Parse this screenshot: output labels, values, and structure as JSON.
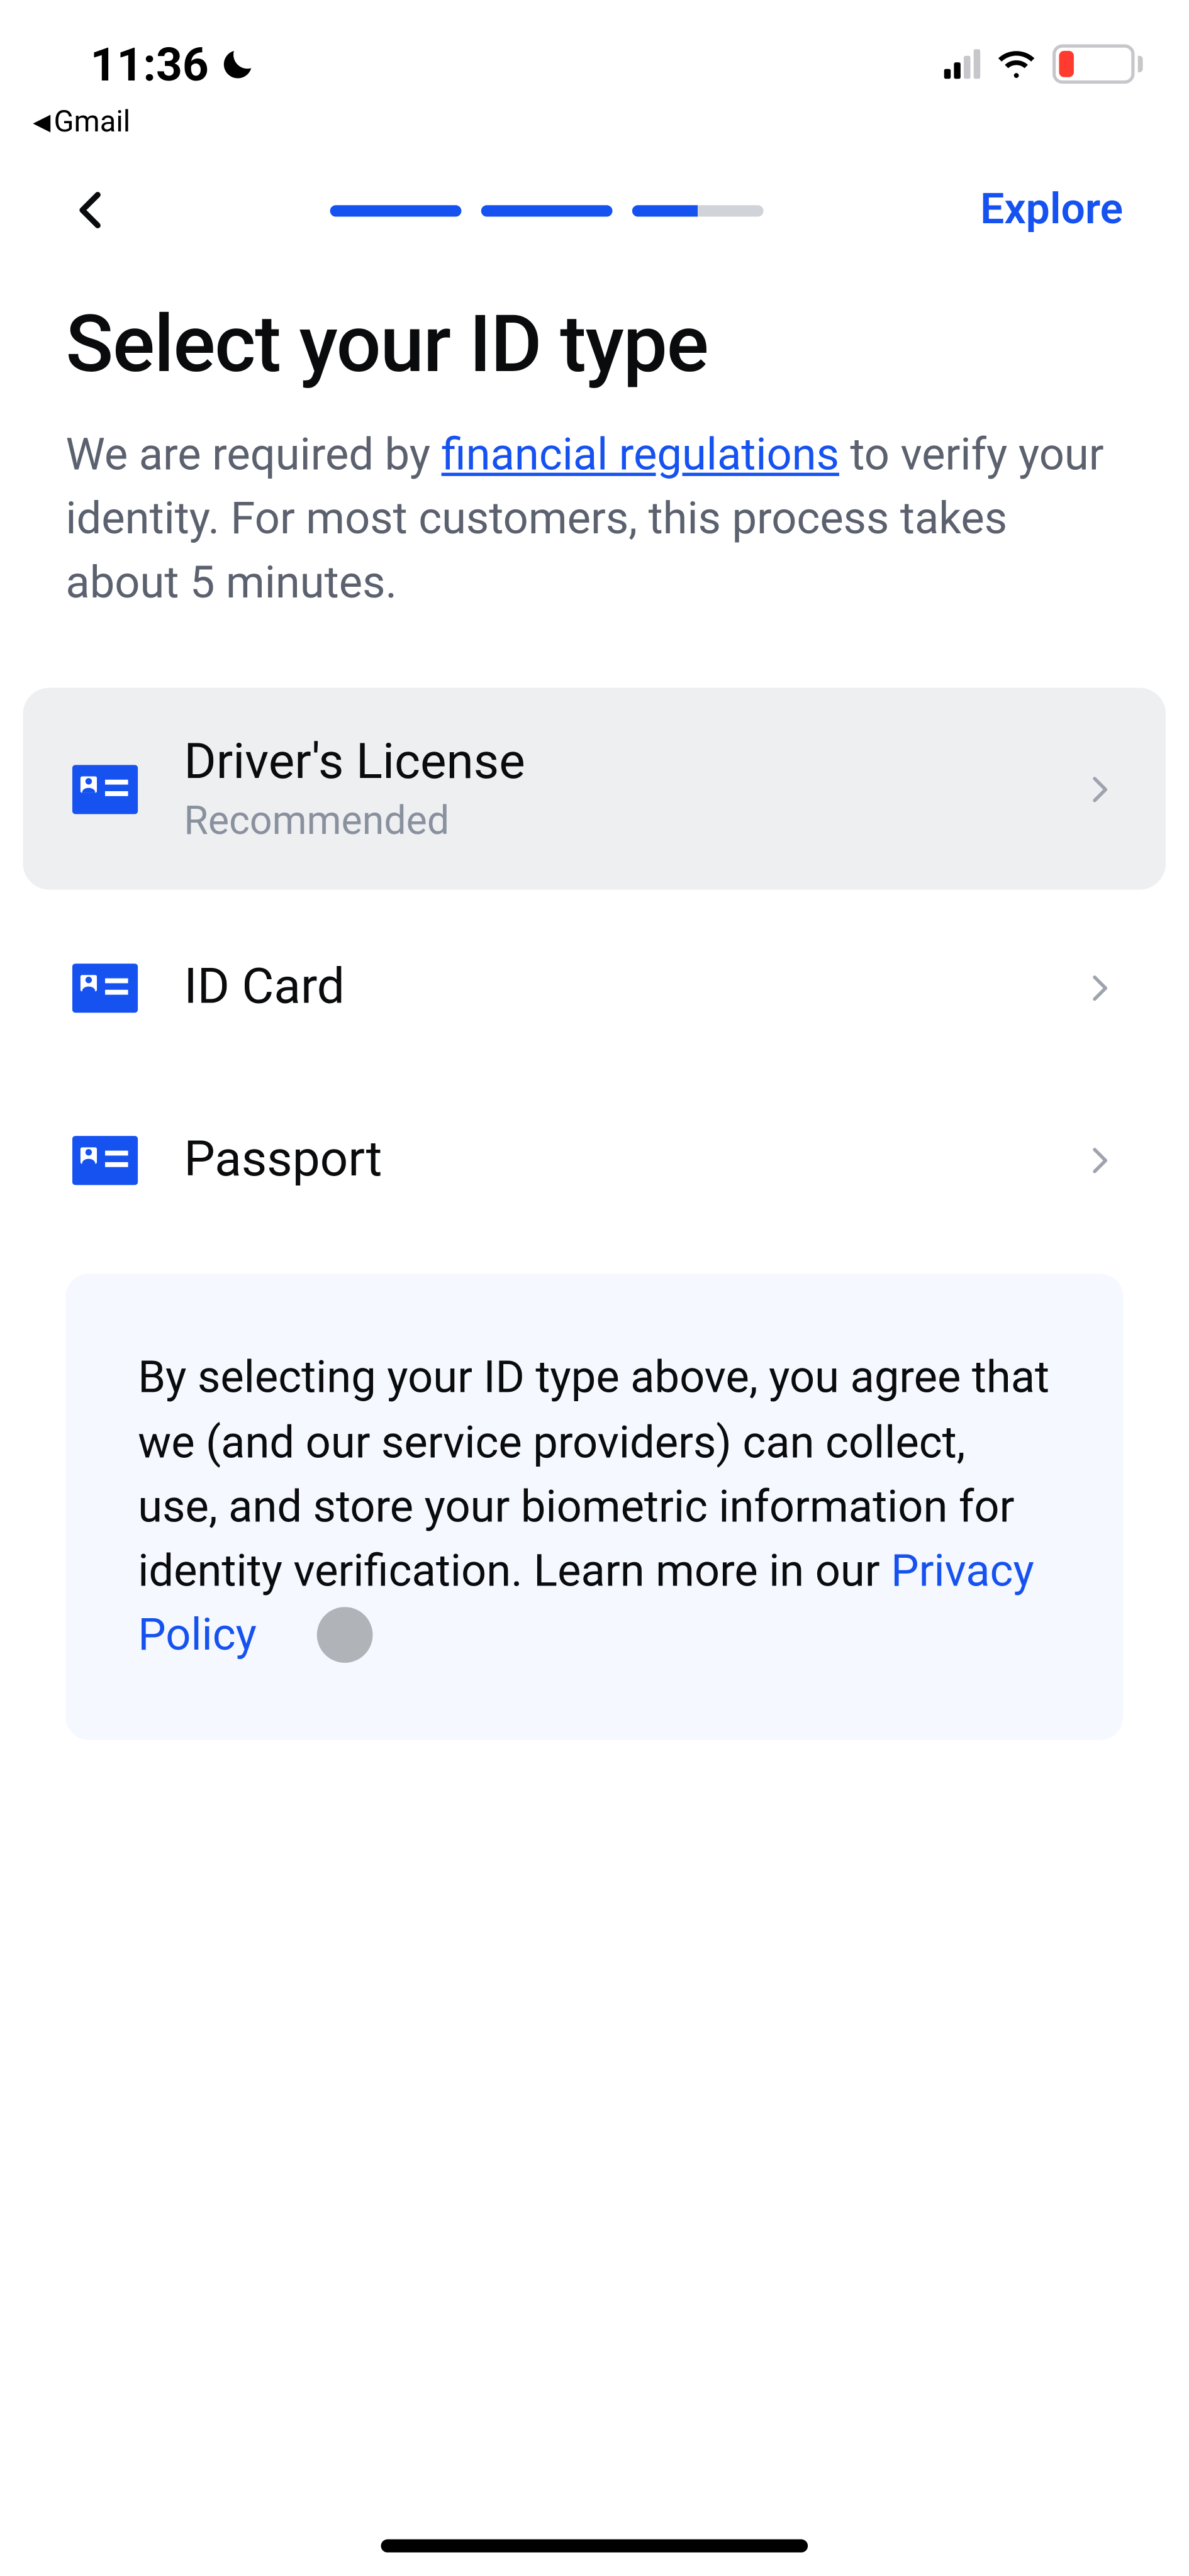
{
  "status": {
    "time": "11:36",
    "return_app": "Gmail",
    "battery_pct": "17",
    "cell_active_bars": 2
  },
  "nav": {
    "explore": "Explore"
  },
  "header": {
    "title": "Select your ID type",
    "sub_pre": "We are required by ",
    "sub_link": "financial regulations",
    "sub_post": " to verify your identity. For most customers, this process takes about 5 minutes."
  },
  "options": [
    {
      "title": "Driver's License",
      "sub": "Recommended",
      "highlight": true
    },
    {
      "title": "ID Card",
      "sub": "",
      "highlight": false
    },
    {
      "title": "Passport",
      "sub": "",
      "highlight": false
    }
  ],
  "disclosure": {
    "text": "By selecting your ID type above, you agree that we (and our service providers) can collect, use, and store your biometric information for identity verification. Learn more in our ",
    "link": "Privacy Policy"
  },
  "colors": {
    "accent": "#1652f0",
    "battery_low": "#ff3b30"
  }
}
